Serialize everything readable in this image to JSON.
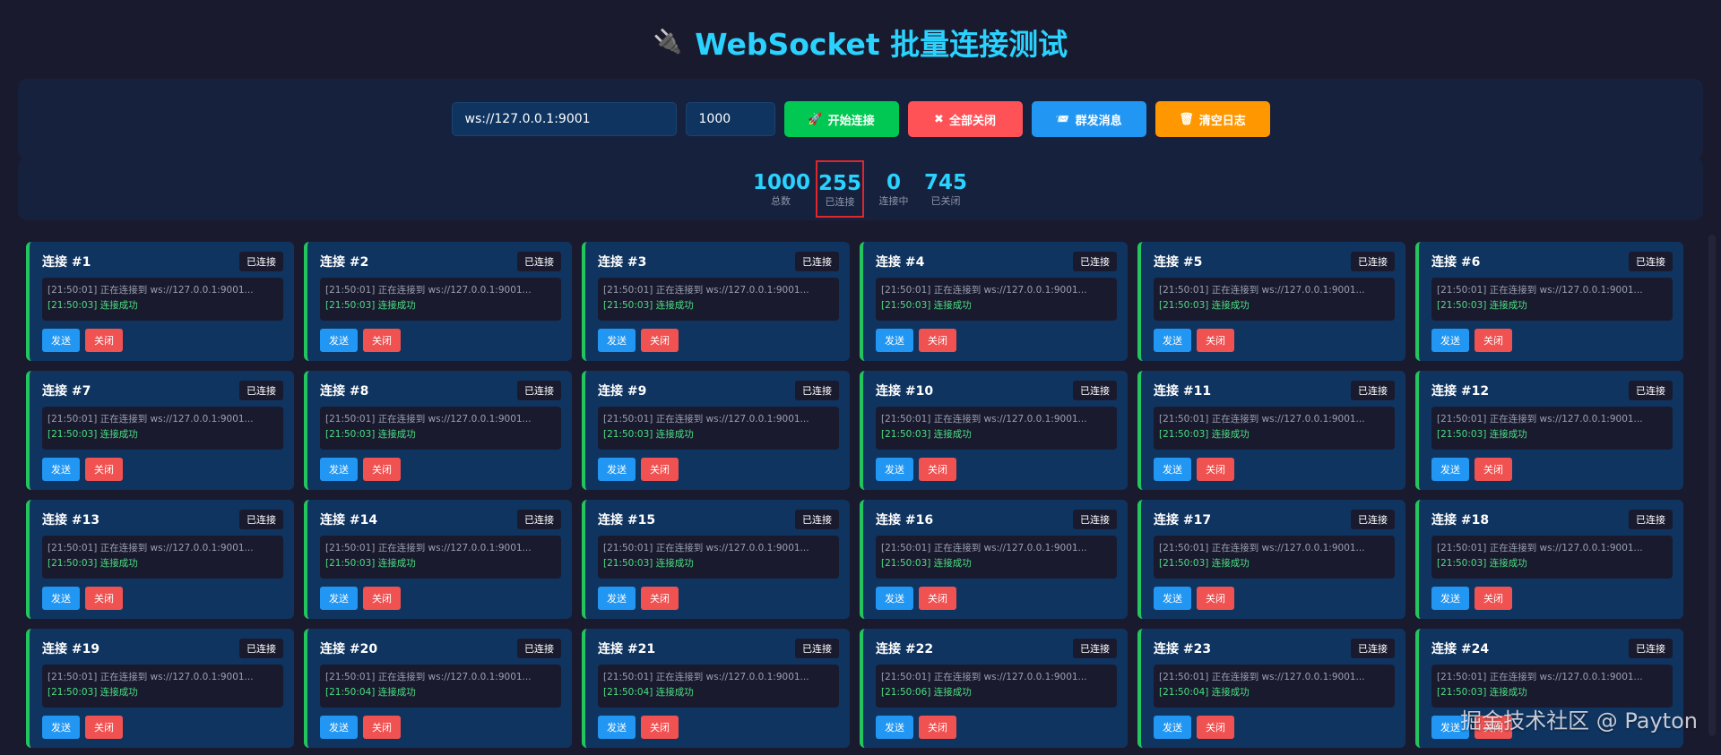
{
  "header": {
    "icon": "plug-icon",
    "plug_glyph": "🔌",
    "title": "WebSocket 批量连接测试"
  },
  "controls": {
    "url_value": "ws://127.0.0.1:9001",
    "count_value": "1000",
    "buttons": [
      {
        "label": "开始连接",
        "glyph": "🚀",
        "icon": "rocket-icon",
        "color": "#00c853"
      },
      {
        "label": "全部关闭",
        "glyph": "✖",
        "icon": "close-icon",
        "color": "#ff5257"
      },
      {
        "label": "群发消息",
        "glyph": "📨",
        "icon": "mail-icon",
        "color": "#2196f3"
      },
      {
        "label": "清空日志",
        "glyph": "🗑",
        "icon": "trash-icon",
        "color": "#ff9800"
      }
    ]
  },
  "stats": [
    {
      "value": "1000",
      "label": "总数"
    },
    {
      "value": "255",
      "label": "已连接"
    },
    {
      "value": "0",
      "label": "连接中"
    },
    {
      "value": "745",
      "label": "已关闭"
    }
  ],
  "colors": {
    "accent": "#2ad3ff",
    "connected": "#22c55e",
    "panel": "#16213e",
    "card": "#0f3460"
  },
  "card_labels": {
    "badge": "已连接",
    "send": "发送",
    "close": "关闭"
  },
  "connections": [
    {
      "title": "连接 #1",
      "log1": "[21:50:01] 正在连接到 ws://127.0.0.1:9001...",
      "log2": "[21:50:03] 连接成功"
    },
    {
      "title": "连接 #2",
      "log1": "[21:50:01] 正在连接到 ws://127.0.0.1:9001...",
      "log2": "[21:50:03] 连接成功"
    },
    {
      "title": "连接 #3",
      "log1": "[21:50:01] 正在连接到 ws://127.0.0.1:9001...",
      "log2": "[21:50:03] 连接成功"
    },
    {
      "title": "连接 #4",
      "log1": "[21:50:01] 正在连接到 ws://127.0.0.1:9001...",
      "log2": "[21:50:03] 连接成功"
    },
    {
      "title": "连接 #5",
      "log1": "[21:50:01] 正在连接到 ws://127.0.0.1:9001...",
      "log2": "[21:50:03] 连接成功"
    },
    {
      "title": "连接 #6",
      "log1": "[21:50:01] 正在连接到 ws://127.0.0.1:9001...",
      "log2": "[21:50:03] 连接成功"
    },
    {
      "title": "连接 #7",
      "log1": "[21:50:01] 正在连接到 ws://127.0.0.1:9001...",
      "log2": "[21:50:03] 连接成功"
    },
    {
      "title": "连接 #8",
      "log1": "[21:50:01] 正在连接到 ws://127.0.0.1:9001...",
      "log2": "[21:50:03] 连接成功"
    },
    {
      "title": "连接 #9",
      "log1": "[21:50:01] 正在连接到 ws://127.0.0.1:9001...",
      "log2": "[21:50:03] 连接成功"
    },
    {
      "title": "连接 #10",
      "log1": "[21:50:01] 正在连接到 ws://127.0.0.1:9001...",
      "log2": "[21:50:03] 连接成功"
    },
    {
      "title": "连接 #11",
      "log1": "[21:50:01] 正在连接到 ws://127.0.0.1:9001...",
      "log2": "[21:50:03] 连接成功"
    },
    {
      "title": "连接 #12",
      "log1": "[21:50:01] 正在连接到 ws://127.0.0.1:9001...",
      "log2": "[21:50:03] 连接成功"
    },
    {
      "title": "连接 #13",
      "log1": "[21:50:01] 正在连接到 ws://127.0.0.1:9001...",
      "log2": "[21:50:03] 连接成功"
    },
    {
      "title": "连接 #14",
      "log1": "[21:50:01] 正在连接到 ws://127.0.0.1:9001...",
      "log2": "[21:50:03] 连接成功"
    },
    {
      "title": "连接 #15",
      "log1": "[21:50:01] 正在连接到 ws://127.0.0.1:9001...",
      "log2": "[21:50:03] 连接成功"
    },
    {
      "title": "连接 #16",
      "log1": "[21:50:01] 正在连接到 ws://127.0.0.1:9001...",
      "log2": "[21:50:03] 连接成功"
    },
    {
      "title": "连接 #17",
      "log1": "[21:50:01] 正在连接到 ws://127.0.0.1:9001...",
      "log2": "[21:50:03] 连接成功"
    },
    {
      "title": "连接 #18",
      "log1": "[21:50:01] 正在连接到 ws://127.0.0.1:9001...",
      "log2": "[21:50:03] 连接成功"
    },
    {
      "title": "连接 #19",
      "log1": "[21:50:01] 正在连接到 ws://127.0.0.1:9001...",
      "log2": "[21:50:03] 连接成功"
    },
    {
      "title": "连接 #20",
      "log1": "[21:50:01] 正在连接到 ws://127.0.0.1:9001...",
      "log2": "[21:50:04] 连接成功"
    },
    {
      "title": "连接 #21",
      "log1": "[21:50:01] 正在连接到 ws://127.0.0.1:9001...",
      "log2": "[21:50:04] 连接成功"
    },
    {
      "title": "连接 #22",
      "log1": "[21:50:01] 正在连接到 ws://127.0.0.1:9001...",
      "log2": "[21:50:06] 连接成功"
    },
    {
      "title": "连接 #23",
      "log1": "[21:50:01] 正在连接到 ws://127.0.0.1:9001...",
      "log2": "[21:50:04] 连接成功"
    },
    {
      "title": "连接 #24",
      "log1": "[21:50:01] 正在连接到 ws://127.0.0.1:9001...",
      "log2": "[21:50:03] 连接成功"
    }
  ],
  "watermark": "掘金技术社区 @ Payton"
}
